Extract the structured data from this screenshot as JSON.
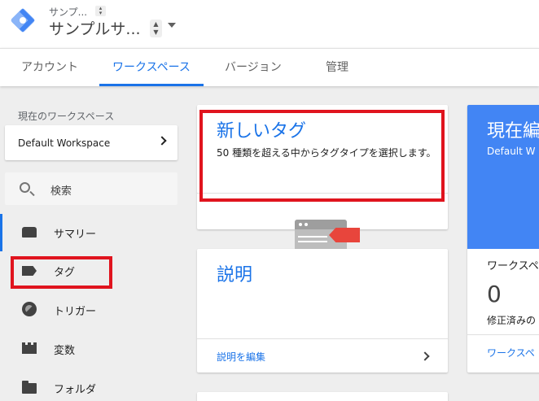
{
  "header": {
    "account_name": "サンプ...",
    "container_name": "サンプルサ...",
    "colors": {
      "brand": "#1a73e8",
      "accent_red": "#e0141e",
      "card_blue": "#4285f4"
    }
  },
  "tabs": [
    {
      "label": "アカウント",
      "active": false
    },
    {
      "label": "ワークスペース",
      "active": true
    },
    {
      "label": "バージョン",
      "active": false
    },
    {
      "label": "管理",
      "active": false
    }
  ],
  "sidebar": {
    "workspace_label": "現在のワークスペース",
    "workspace_name": "Default Workspace",
    "search_label": "検索",
    "items": [
      {
        "label": "サマリー",
        "icon": "summary-icon",
        "active": true
      },
      {
        "label": "タグ",
        "icon": "tag-icon",
        "active": false
      },
      {
        "label": "トリガー",
        "icon": "trigger-icon",
        "active": false
      },
      {
        "label": "変数",
        "icon": "variable-icon",
        "active": false
      },
      {
        "label": "フォルダ",
        "icon": "folder-icon",
        "active": false
      }
    ]
  },
  "new_tag_card": {
    "title": "新しいタグ",
    "description": "50 種類を超える中からタグタイプを選択します。"
  },
  "description_card": {
    "title": "説明",
    "edit_link": "説明を編集"
  },
  "current_workspace_card": {
    "title": "現在編",
    "subtitle": "Default W",
    "label": "ワークスペ",
    "count": "0",
    "count_label": "修正済みの",
    "link": "ワークスペ"
  }
}
